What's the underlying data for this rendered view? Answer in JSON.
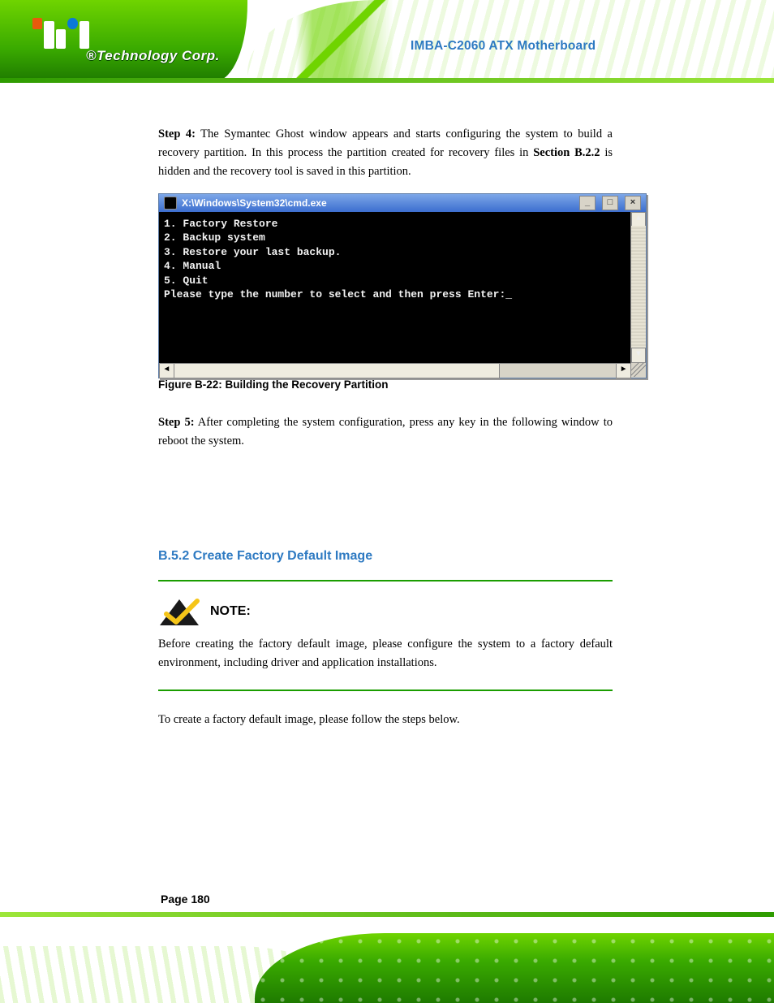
{
  "logo_brand": "®Technology Corp.",
  "doc_title": "IMBA-C2060 ATX Motherboard",
  "para1_prefix": "Step 4:",
  "para1_body": "The Symantec Ghost window appears and starts configuring the system to build a recovery partition. In this process the partition created for recovery files in ",
  "para1_bold_ref": "Section B.2.2",
  "para1_body2": " is hidden and the recovery tool is saved in this partition.",
  "figure_caption": "Figure B-22: Building the Recovery Partition",
  "para2_prefix": "Step 5:",
  "para2_body": "After completing the system configuration, press any key in the following window to reboot the system.",
  "section_heading": "B.5.2  Create Factory Default Image",
  "note_title": "NOTE:",
  "note_body": "Before creating the factory default image, please configure the system to a factory default environment, including driver and application installations.",
  "para3": "To create a factory default image, please follow the steps below.",
  "page_number": "Page 180",
  "cmd": {
    "title": "X:\\Windows\\System32\\cmd.exe",
    "lines": [
      "1. Factory Restore",
      "2. Backup system",
      "3. Restore your last backup.",
      "4. Manual",
      "5. Quit",
      "Please type the number to select and then press Enter:_"
    ],
    "btn_min": "_",
    "btn_max": "□",
    "btn_close": "×",
    "scroll_up": "▲",
    "scroll_down": "▼",
    "scroll_left": "◄",
    "scroll_right": "►"
  }
}
